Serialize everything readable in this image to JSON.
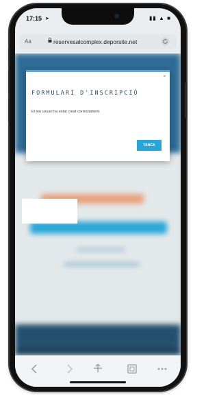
{
  "status": {
    "time": "17:15",
    "icons": "▮▮ ▲ ■"
  },
  "browser": {
    "text_size_label": "Aa",
    "url": "reservesalcomplex.deporsite.net"
  },
  "modal": {
    "close_label": "˟",
    "title": "FORMULARI D'INSCRIPCIÓ",
    "message": "El teu usuari ha estat creat correctament.",
    "button_label": "TANCA"
  },
  "colors": {
    "accent": "#2aa6d6",
    "header_blue": "#2e6c95",
    "modal_title": "#2a4f6a"
  },
  "toolbar": {
    "icons": [
      "back-icon",
      "forward-icon",
      "share-icon",
      "bookmarks-icon",
      "tabs-icon"
    ]
  }
}
